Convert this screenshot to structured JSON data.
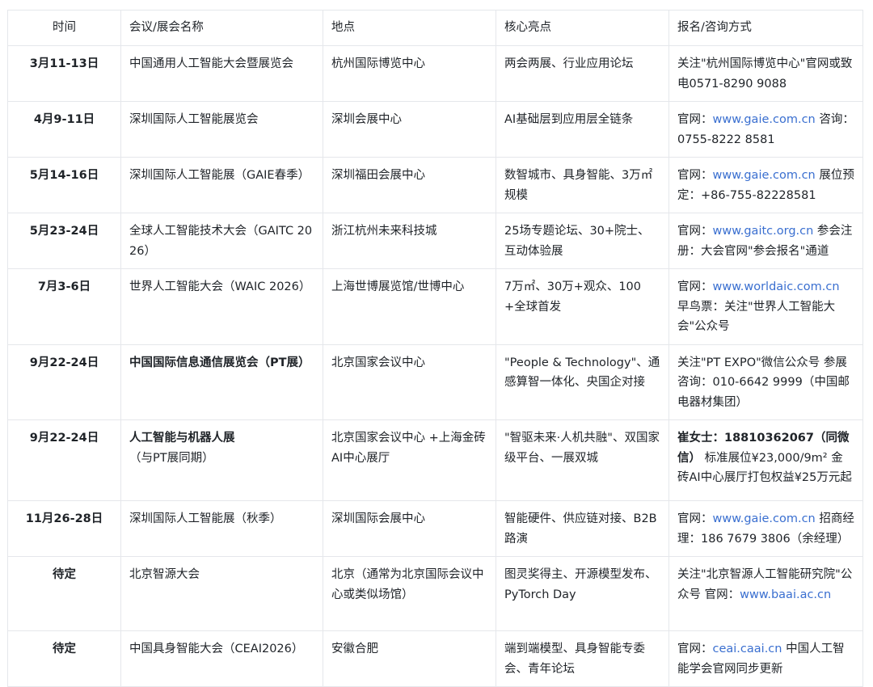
{
  "headers": {
    "time": "时间",
    "name": "会议/展会名称",
    "location": "地点",
    "highlights": "核心亮点",
    "contact": "报名/咨询方式"
  },
  "rows": [
    {
      "time": "3月11-13日",
      "name": "中国通用人工智能大会暨展览会",
      "location": "杭州国际博览中心",
      "highlights": "两会两展、行业应用论坛",
      "contact_pre": "关注\"杭州国际博览中心\"官网或致电0571-8290 9088",
      "contact_link": "",
      "contact_post": ""
    },
    {
      "time": "4月9-11日",
      "name": "深圳国际人工智能展览会",
      "location": "深圳会展中心",
      "highlights": "AI基础层到应用层全链条",
      "contact_pre": "官网：",
      "contact_link": "www.gaie.com.cn",
      "contact_post": " 咨询：0755-8222 8581"
    },
    {
      "time": "5月14-16日",
      "name": "深圳国际人工智能展（GAIE春季）",
      "location": "深圳福田会展中心",
      "highlights": "数智城市、具身智能、3万㎡规模",
      "contact_pre": "官网：",
      "contact_link": "www.gaie.com.cn",
      "contact_post": " 展位预定：+86-755-82228581"
    },
    {
      "time": "5月23-24日",
      "name": "全球人工智能技术大会（GAITC 2026）",
      "location": "浙江杭州未来科技城",
      "highlights": "25场专题论坛、30+院士、互动体验展",
      "contact_pre": "官网：",
      "contact_link": "www.gaitc.org.cn",
      "contact_post": " 参会注册：大会官网\"参会报名\"通道"
    },
    {
      "time": "7月3-6日",
      "name": "世界人工智能大会（WAIC 2026）",
      "location": "上海世博展览馆/世博中心",
      "highlights": "7万㎡、30万+观众、100+全球首发",
      "contact_pre": "官网：",
      "contact_link": "www.worldaic.com.cn",
      "contact_post": " 早鸟票：关注\"世界人工智能大会\"公众号"
    },
    {
      "time": "9月22-24日",
      "name_bold": "中国国际信息通信展览会（PT展）",
      "name": "",
      "location": "北京国家会议中心",
      "highlights": "\"People & Technology\"、通感算智一体化、央国企对接",
      "contact_pre": "关注\"PT EXPO\"微信公众号 参展咨询：010-6642 9999（中国邮电器材集团）",
      "contact_link": "",
      "contact_post": ""
    },
    {
      "time": "9月22-24日",
      "name_bold": "人工智能与机器人展",
      "name": "（与PT展同期）",
      "location": "北京国家会议中心 +上海金砖AI中心展厅",
      "highlights": "\"智驱未来·人机共融\"、双国家级平台、一展双城",
      "contact_bold": "崔女士：18810362067（同微信）",
      "contact_pre": " 标准展位¥23,000/9m² 金砖AI中心展厅打包权益¥25万元起",
      "contact_link": "",
      "contact_post": ""
    },
    {
      "time": "11月26-28日",
      "name": "深圳国际人工智能展（秋季）",
      "location": "深圳国际会展中心",
      "highlights": "智能硬件、供应链对接、B2B路演",
      "contact_pre": "官网：",
      "contact_link": "www.gaie.com.cn",
      "contact_post": " 招商经理：186 7679 3806（余经理）"
    },
    {
      "time": "待定",
      "name": "北京智源大会",
      "location": "北京（通常为北京国际会议中心或类似场馆）",
      "highlights": "图灵奖得主、开源模型发布、PyTorch Day",
      "contact_pre": "关注\"北京智源人工智能研究院\"公众号 官网：",
      "contact_link": "www.baai.ac.cn",
      "contact_post": ""
    },
    {
      "time": "待定",
      "name": "中国具身智能大会（CEAI2026）",
      "location": "安徽合肥",
      "highlights": "端到端模型、具身智能专委会、青年论坛",
      "contact_pre": "官网：",
      "contact_link": "ceai.caai.cn",
      "contact_post": " 中国人工智能学会官网同步更新"
    }
  ],
  "colors": {
    "link": "#3a6fd0",
    "border": "#e5e7eb",
    "text": "#1f2328"
  }
}
